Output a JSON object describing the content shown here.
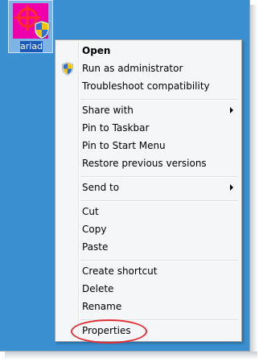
{
  "desktop": {
    "icon_label": "ariad",
    "icon_name": "app-icon-with-uac-shield"
  },
  "colors": {
    "desktop_bg": "#3a8fd0",
    "icon_bg": "#ee00aa",
    "highlight": "#e0303a"
  },
  "menu": {
    "items": [
      {
        "label": "Open",
        "bold": true
      },
      {
        "label": "Run as administrator",
        "icon": "uac-shield-icon"
      },
      {
        "label": "Troubleshoot compatibility"
      },
      {
        "label": "Share with",
        "submenu": true
      },
      {
        "label": "Pin to Taskbar"
      },
      {
        "label": "Pin to Start Menu"
      },
      {
        "label": "Restore previous versions"
      },
      {
        "label": "Send to",
        "submenu": true
      },
      {
        "label": "Cut"
      },
      {
        "label": "Copy"
      },
      {
        "label": "Paste"
      },
      {
        "label": "Create shortcut"
      },
      {
        "label": "Delete"
      },
      {
        "label": "Rename"
      },
      {
        "label": "Properties",
        "highlighted": true
      }
    ]
  }
}
